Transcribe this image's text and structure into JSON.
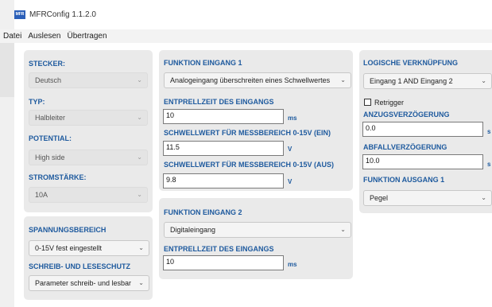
{
  "window": {
    "title": "MFRConfig 1.1.2.0",
    "icon_text": "MFR"
  },
  "menu": [
    "Datei",
    "Auslesen",
    "Übertragen"
  ],
  "panel_stecker": {
    "stecker_label": "STECKER:",
    "stecker_value": "Deutsch",
    "typ_label": "TYP:",
    "typ_value": "Halbleiter",
    "potential_label": "POTENTIAL:",
    "potential_value": "High side",
    "stromstaerke_label": "STROMSTÄRKE:",
    "stromstaerke_value": "10A"
  },
  "panel_spannung": {
    "spannung_label": "SPANNUNGSBEREICH",
    "spannung_value": "0-15V fest eingestellt",
    "schutz_label": "SCHREIB- UND LESESCHUTZ",
    "schutz_value": "Parameter schreib- und lesbar"
  },
  "panel_eingang1": {
    "title": "FUNKTION EINGANG 1",
    "funktion_value": "Analogeingang überschreiten eines Schwellwertes",
    "entprell_label": "ENTPRELLZEIT DES EINGANGS",
    "entprell_value": "10",
    "entprell_unit": "ms",
    "schwell_ein_label": "SCHWELLWERT FÜR MESSBEREICH 0-15V (EIN)",
    "schwell_ein_value": "11.5",
    "schwell_ein_unit": "V",
    "schwell_aus_label": "SCHWELLWERT FÜR MESSBEREICH 0-15V (AUS)",
    "schwell_aus_value": "9.8",
    "schwell_aus_unit": "V"
  },
  "panel_eingang2": {
    "title": "FUNKTION EINGANG 2",
    "funktion_value": "Digitaleingang",
    "entprell_label": "ENTPRELLZEIT DES EINGANGS",
    "entprell_value": "10",
    "entprell_unit": "ms"
  },
  "panel_logik": {
    "title": "LOGISCHE VERKNÜPFUNG",
    "verknuepfung_value": "Eingang 1 AND Eingang 2",
    "retrigger_label": "Retrigger",
    "retrigger_checked": false,
    "anzug_label": "ANZUGSVERZÖGERUNG",
    "anzug_value": "0.0",
    "anzug_unit": "s",
    "abfall_label": "ABFALLVERZÖGERUNG",
    "abfall_value": "10.0",
    "abfall_unit": "s",
    "ausgang_label": "FUNKTION AUSGANG 1",
    "ausgang_value": "Pegel"
  },
  "icons": {
    "chevron": "chevron-down-icon",
    "checkbox": "checkbox-icon"
  },
  "colors": {
    "label_blue": "#1e5a9e",
    "panel_bg": "#eaeaea",
    "app_icon": "#2b5fb8"
  }
}
